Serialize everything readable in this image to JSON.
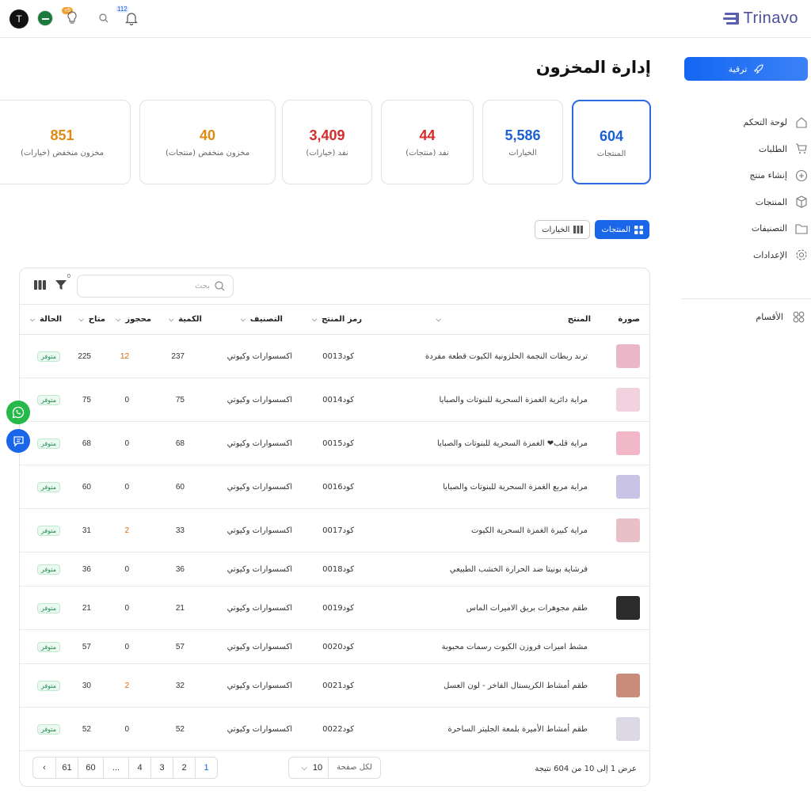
{
  "brand": {
    "name": "Trinavo"
  },
  "topbar": {
    "avatar_letter": "T",
    "notifications_count": "112",
    "points_badge": "+5"
  },
  "sidebar": {
    "upgrade_label": "ترقية",
    "items": [
      {
        "label": "لوحة التحكم",
        "icon": "home-icon"
      },
      {
        "label": "الطلبات",
        "icon": "cart-icon"
      },
      {
        "label": "إنشاء منتج",
        "icon": "plus-circle-icon"
      },
      {
        "label": "المنتجات",
        "icon": "box-icon"
      },
      {
        "label": "التصنيفات",
        "icon": "folder-icon"
      },
      {
        "label": "الإعدادات",
        "icon": "gear-icon"
      }
    ],
    "sections_label": "الأقسام"
  },
  "page": {
    "title": "إدارة المخزون"
  },
  "stats": [
    {
      "value": "604",
      "label": "المنتجات",
      "color": "#1a5fd6"
    },
    {
      "value": "5,586",
      "label": "الخيارات",
      "color": "#1a5fd6"
    },
    {
      "value": "44",
      "label": "نفد (منتجات)",
      "color": "#d42b2b"
    },
    {
      "value": "3,409",
      "label": "نفد (خيارات)",
      "color": "#d42b2b"
    },
    {
      "value": "40",
      "label": "مخزون منخفض (منتجات)",
      "color": "#e08a12"
    },
    {
      "value": "851",
      "label": "مخزون منخفض (خيارات)",
      "color": "#e08a12"
    }
  ],
  "tabs": {
    "products": "المنتجات",
    "variants": "الخيارات"
  },
  "table": {
    "search_placeholder": "بحث",
    "filter_count": "0",
    "columns": [
      "صورة",
      "المنتج",
      "رمز المنتج",
      "التصنيف",
      "الكمية",
      "محجوز",
      "متاح",
      "الحالة"
    ],
    "rows": [
      {
        "name": "ترند ربطات النجمة الحلزونية الكيوت قطعة مفردة",
        "code": "كود0013",
        "category": "اكسسوارات وكيوتي",
        "qty": "237",
        "reserved": "12",
        "available": "225",
        "status": "متوفر",
        "thumb": "#e9b7c7"
      },
      {
        "name": "مراية دائرية الغمزة السحرية للبنوتات والصبايا",
        "code": "كود0014",
        "category": "اكسسوارات وكيوتي",
        "qty": "75",
        "reserved": "0",
        "available": "75",
        "status": "متوفر",
        "thumb": "#f3d2e0"
      },
      {
        "name": "مراية قلب❤ الغمزة السحرية للبنوتات والصبايا",
        "code": "كود0015",
        "category": "اكسسوارات وكيوتي",
        "qty": "68",
        "reserved": "0",
        "available": "68",
        "status": "متوفر",
        "thumb": "#f0b8c8"
      },
      {
        "name": "مراية مربع الغمزة السحرية للبنوتات والصبايا",
        "code": "كود0016",
        "category": "اكسسوارات وكيوتي",
        "qty": "60",
        "reserved": "0",
        "available": "60",
        "status": "متوفر",
        "thumb": "#c9c3e6"
      },
      {
        "name": "مراية كبيرة الغمزة السحرية الكيوت",
        "code": "كود0017",
        "category": "اكسسوارات وكيوتي",
        "qty": "33",
        "reserved": "2",
        "available": "31",
        "status": "متوفر",
        "thumb": "#eac0c8"
      },
      {
        "name": "فرشاية بونيتا ضد الحرارة الخشب الطبيعي",
        "code": "كود0018",
        "category": "اكسسوارات وكيوتي",
        "qty": "36",
        "reserved": "0",
        "available": "36",
        "status": "متوفر",
        "thumb": ""
      },
      {
        "name": "طقم مجوهرات بريق الاميرات الماس",
        "code": "كود0019",
        "category": "اكسسوارات وكيوتي",
        "qty": "21",
        "reserved": "0",
        "available": "21",
        "status": "متوفر",
        "thumb": "#2b2b2b"
      },
      {
        "name": "مشط اميرات فروزن الكيوت رسمات محبوبة",
        "code": "كود0020",
        "category": "اكسسوارات وكيوتي",
        "qty": "57",
        "reserved": "0",
        "available": "57",
        "status": "متوفر",
        "thumb": ""
      },
      {
        "name": "طقم أمشاط الكريستال الفاخر - لون العسل",
        "code": "كود0021",
        "category": "اكسسوارات وكيوتي",
        "qty": "32",
        "reserved": "2",
        "available": "30",
        "status": "متوفر",
        "thumb": "#c98c7a"
      },
      {
        "name": "طقم أمشاط الأميرة بلمعة الجليتر الساحرة",
        "code": "كود0022",
        "category": "اكسسوارات وكيوتي",
        "qty": "52",
        "reserved": "0",
        "available": "52",
        "status": "متوفر",
        "thumb": "#dcd8e6"
      }
    ]
  },
  "pagination": {
    "summary": "عرض 1 إلى 10 من 604 نتيجة",
    "per_page_label": "لكل صفحة",
    "per_page_value": "10",
    "pages": [
      "1",
      "2",
      "3",
      "4",
      "...",
      "60",
      "61"
    ]
  }
}
